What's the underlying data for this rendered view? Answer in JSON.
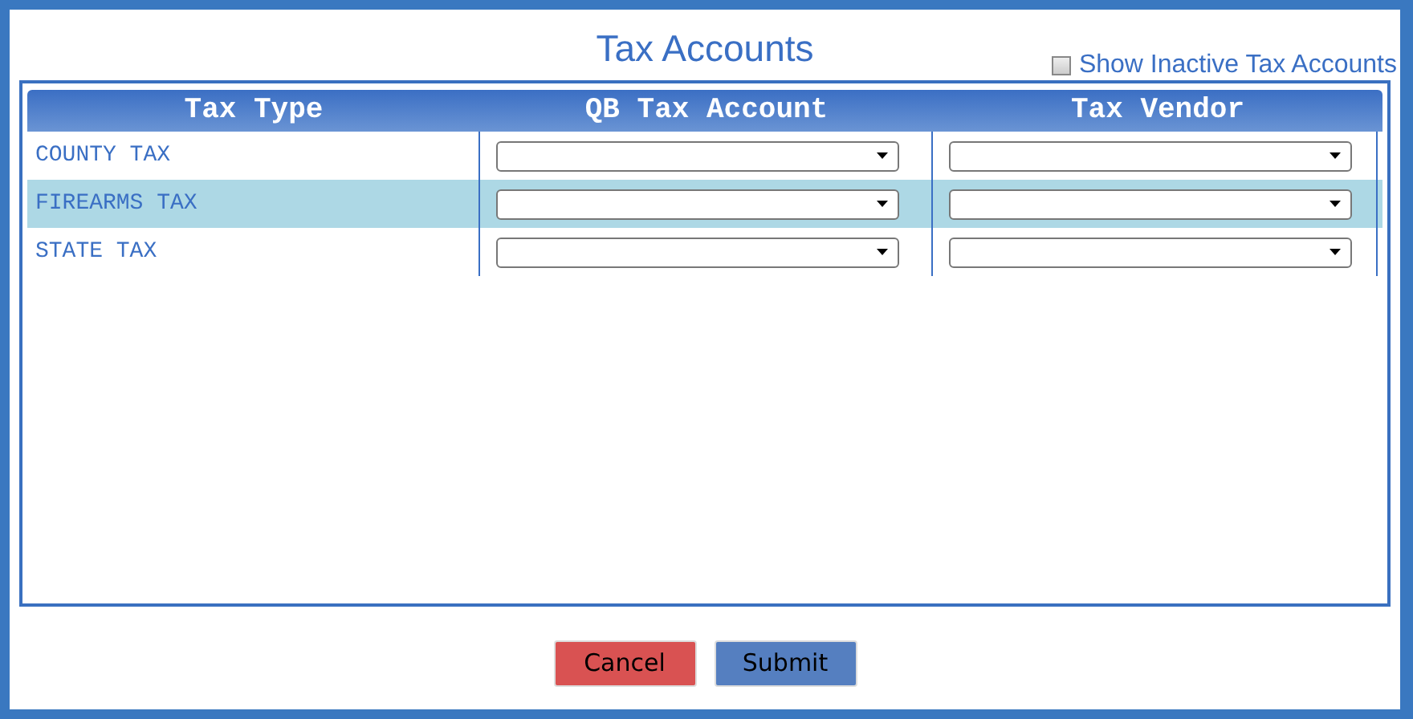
{
  "dialog": {
    "title": "Tax Accounts"
  },
  "show_inactive": {
    "label": "Show Inactive Tax Accounts",
    "checked": false
  },
  "table": {
    "columns": [
      "Tax Type",
      "QB Tax Account",
      "Tax Vendor"
    ],
    "rows": [
      {
        "tax_type": "COUNTY TAX",
        "selected": false
      },
      {
        "tax_type": "FIREARMS TAX",
        "selected": true
      },
      {
        "tax_type": "STATE TAX",
        "selected": false
      }
    ]
  },
  "buttons": [
    {
      "label": "Cancel",
      "kind": "cancel"
    },
    {
      "label": "Submit",
      "kind": "submit"
    }
  ]
}
